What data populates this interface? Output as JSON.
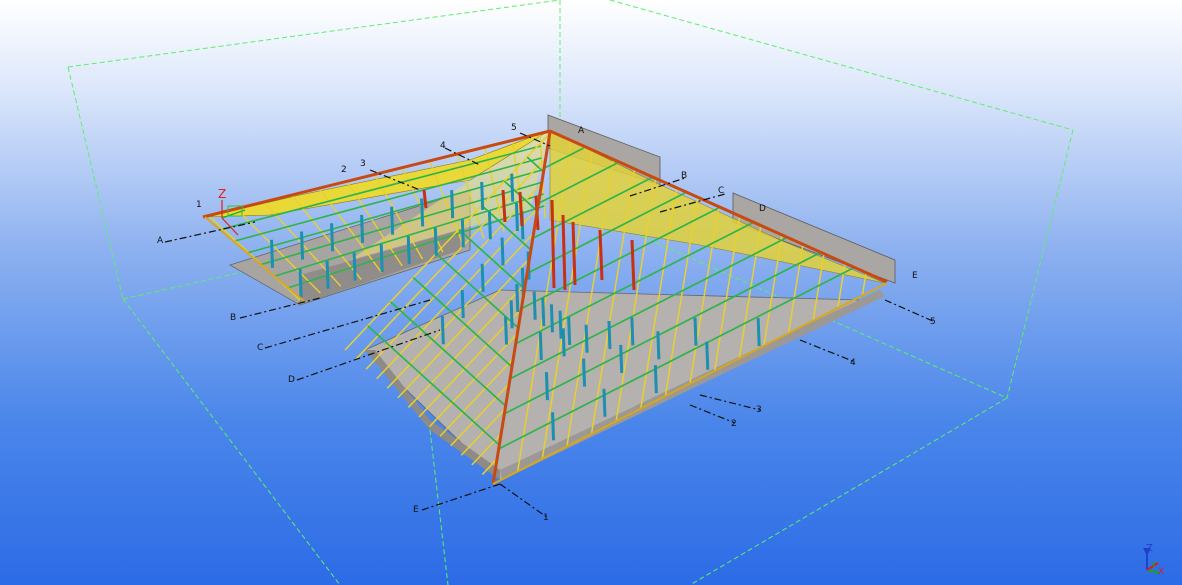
{
  "view": {
    "background_top": "#ffffff",
    "background_bottom": "#2c6be6",
    "work_area_color": "#5cf06a",
    "roof_color": "#e8d838",
    "wall_color": "#a9a6a4",
    "purlin_color": "#2fb44a",
    "post_color": "#1d8fb0",
    "rafter_color": "#c93010"
  },
  "grid_labels": {
    "left": [
      "1",
      "2",
      "3",
      "4",
      "5"
    ],
    "left_letters": [
      "A",
      "B",
      "C",
      "D",
      "E"
    ],
    "right_letters": [
      "A",
      "B",
      "C",
      "D",
      "E"
    ],
    "right_numbers": [
      "5",
      "4",
      "3",
      "2",
      "1"
    ]
  },
  "local_axes": {
    "z": "Z"
  },
  "view_triad": {
    "z": "Z",
    "y": "Y",
    "x": "X"
  }
}
